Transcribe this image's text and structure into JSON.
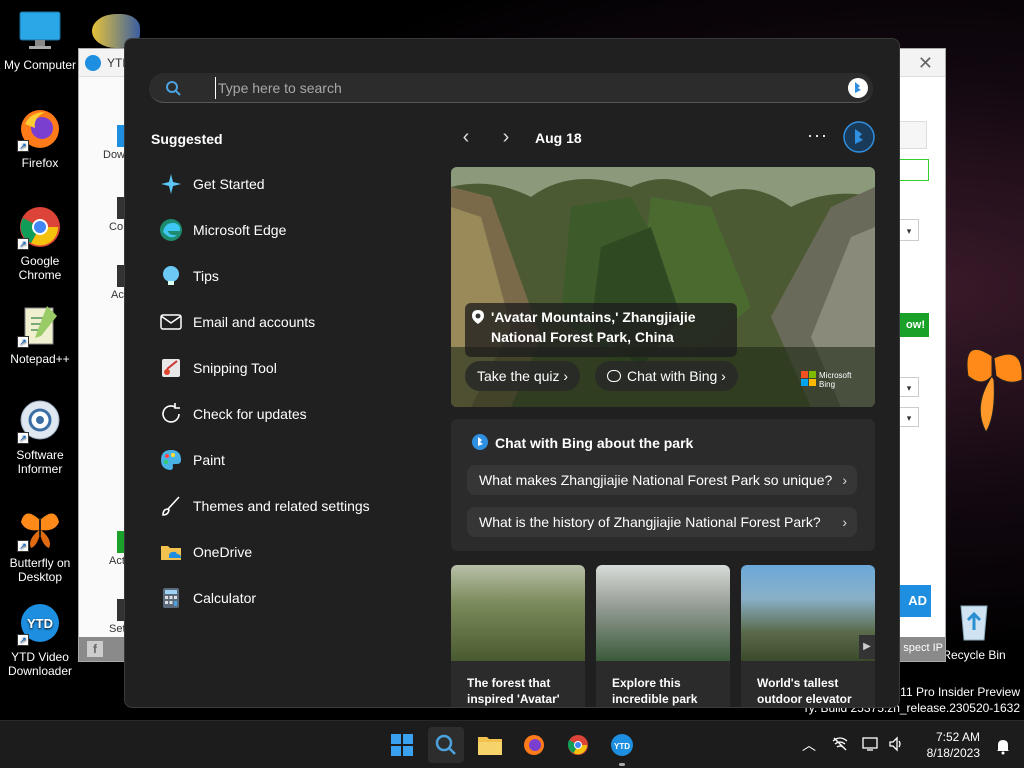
{
  "desktop": {
    "icons": [
      {
        "label": "My Computer"
      },
      {
        "label": "Firefox"
      },
      {
        "label": "Google Chrome"
      },
      {
        "label": "Notepad++"
      },
      {
        "label": "Software Informer"
      },
      {
        "label": "Butterfly on Desktop"
      },
      {
        "label": "YTD Video Downloader"
      },
      {
        "label": "Recycle Bin"
      }
    ],
    "watermark_line1": "s 11 Pro Insider Preview",
    "watermark_line2": "ry. Build 25375.zn_release.230520-1632"
  },
  "ytd_window": {
    "title": "YTD",
    "close_glyph": "✕",
    "side_labels": [
      "Dow",
      "Co",
      "Ac",
      "Act",
      "Set"
    ],
    "green_button_label": "ow!",
    "download_label": "AD",
    "inspect_label": "spect IP"
  },
  "search": {
    "placeholder": "Type here to search",
    "suggested_title": "Suggested",
    "suggestions": [
      {
        "label": "Get Started"
      },
      {
        "label": "Microsoft Edge"
      },
      {
        "label": "Tips"
      },
      {
        "label": "Email and accounts"
      },
      {
        "label": "Snipping Tool"
      },
      {
        "label": "Check for updates"
      },
      {
        "label": "Paint"
      },
      {
        "label": "Themes and related settings"
      },
      {
        "label": "OneDrive"
      },
      {
        "label": "Calculator"
      }
    ],
    "date": "Aug 18",
    "more_glyph": "···",
    "hero": {
      "location": "'Avatar Mountains,' Zhangjiajie National Forest Park, China",
      "quiz_label": "Take the quiz",
      "chat_label": "Chat with Bing",
      "logo_line1": "Microsoft",
      "logo_line2": "Bing"
    },
    "chat": {
      "title": "Chat with Bing about the park",
      "questions": [
        "What makes Zhangjiajie National Forest Park so unique?",
        "What is the history of Zhangjiajie National Forest Park?"
      ]
    },
    "thumbs": [
      {
        "caption": "The forest that inspired 'Avatar'"
      },
      {
        "caption": "Explore this incredible park"
      },
      {
        "caption": "World's tallest outdoor elevator"
      }
    ]
  },
  "taskbar": {
    "time": "7:52 AM",
    "date": "8/18/2023"
  },
  "colors": {
    "panel_bg": "#202020",
    "accent": "#0078d4",
    "bing_blue": "#2f8fe0"
  }
}
